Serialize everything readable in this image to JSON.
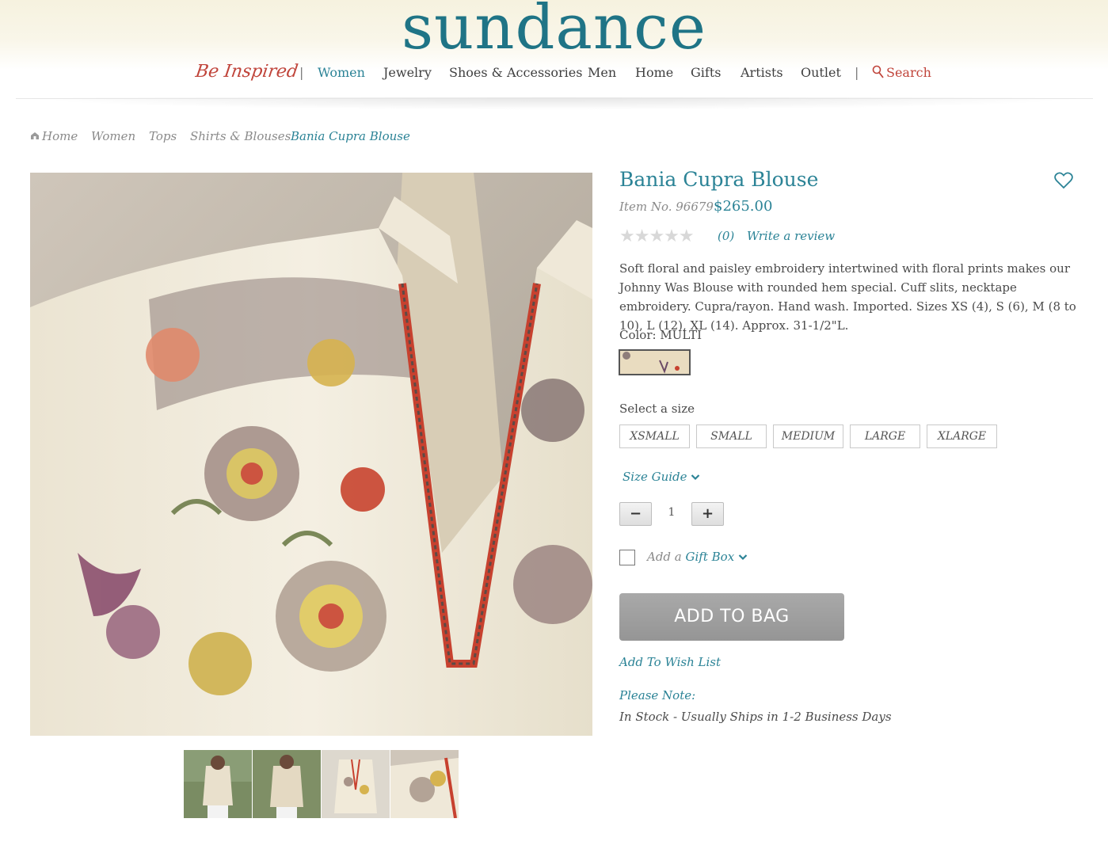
{
  "brand": {
    "logo_text": "sundance"
  },
  "nav": {
    "tagline": "Be Inspired",
    "separator": "|",
    "items": [
      {
        "label": "Women",
        "active": true
      },
      {
        "label": "Jewelry"
      },
      {
        "label": "Shoes & Accessories"
      },
      {
        "label": "Men"
      },
      {
        "label": "Home"
      },
      {
        "label": "Gifts"
      },
      {
        "label": "Artists"
      },
      {
        "label": "Outlet"
      }
    ],
    "search_label": "Search"
  },
  "breadcrumb": [
    {
      "label": "Home",
      "icon": "home-icon"
    },
    {
      "label": "Women"
    },
    {
      "label": "Tops"
    },
    {
      "label": "Shirts & Blouses"
    },
    {
      "label": "Bania Cupra Blouse",
      "current": true
    }
  ],
  "product": {
    "title": "Bania Cupra Blouse",
    "item_no": "Item No. 96679",
    "price": "$265.00",
    "rating": {
      "stars": "★★★★★",
      "count": "(0)",
      "write_review": "Write a review"
    },
    "description": "Soft floral and paisley embroidery intertwined with floral prints makes our Johnny Was Blouse with rounded hem special. Cuff slits, necktape embroidery. Cupra/rayon. Hand wash. Imported. Sizes XS (4), S (6), M (8 to 10), L (12), XL (14). Approx. 31-1/2\"L.",
    "color_label": "Color: MULTI",
    "size_label": "Select a size",
    "sizes": [
      "XSMALL",
      "SMALL",
      "MEDIUM",
      "LARGE",
      "XLARGE"
    ],
    "size_guide": "Size Guide",
    "quantity": {
      "minus": "−",
      "value": "1",
      "plus": "+"
    },
    "gift": {
      "prefix": "Add a ",
      "link": "Gift Box"
    },
    "add_to_bag": "ADD TO BAG",
    "wish_list": "Add To Wish List",
    "note_label": "Please Note:",
    "stock": "In Stock - Usually Ships in 1-2 Business Days"
  },
  "colors": {
    "accent": "#2b8396",
    "logo": "#1f7486",
    "brand_red": "#c0443a",
    "button_gray": "#9e9e9e"
  }
}
